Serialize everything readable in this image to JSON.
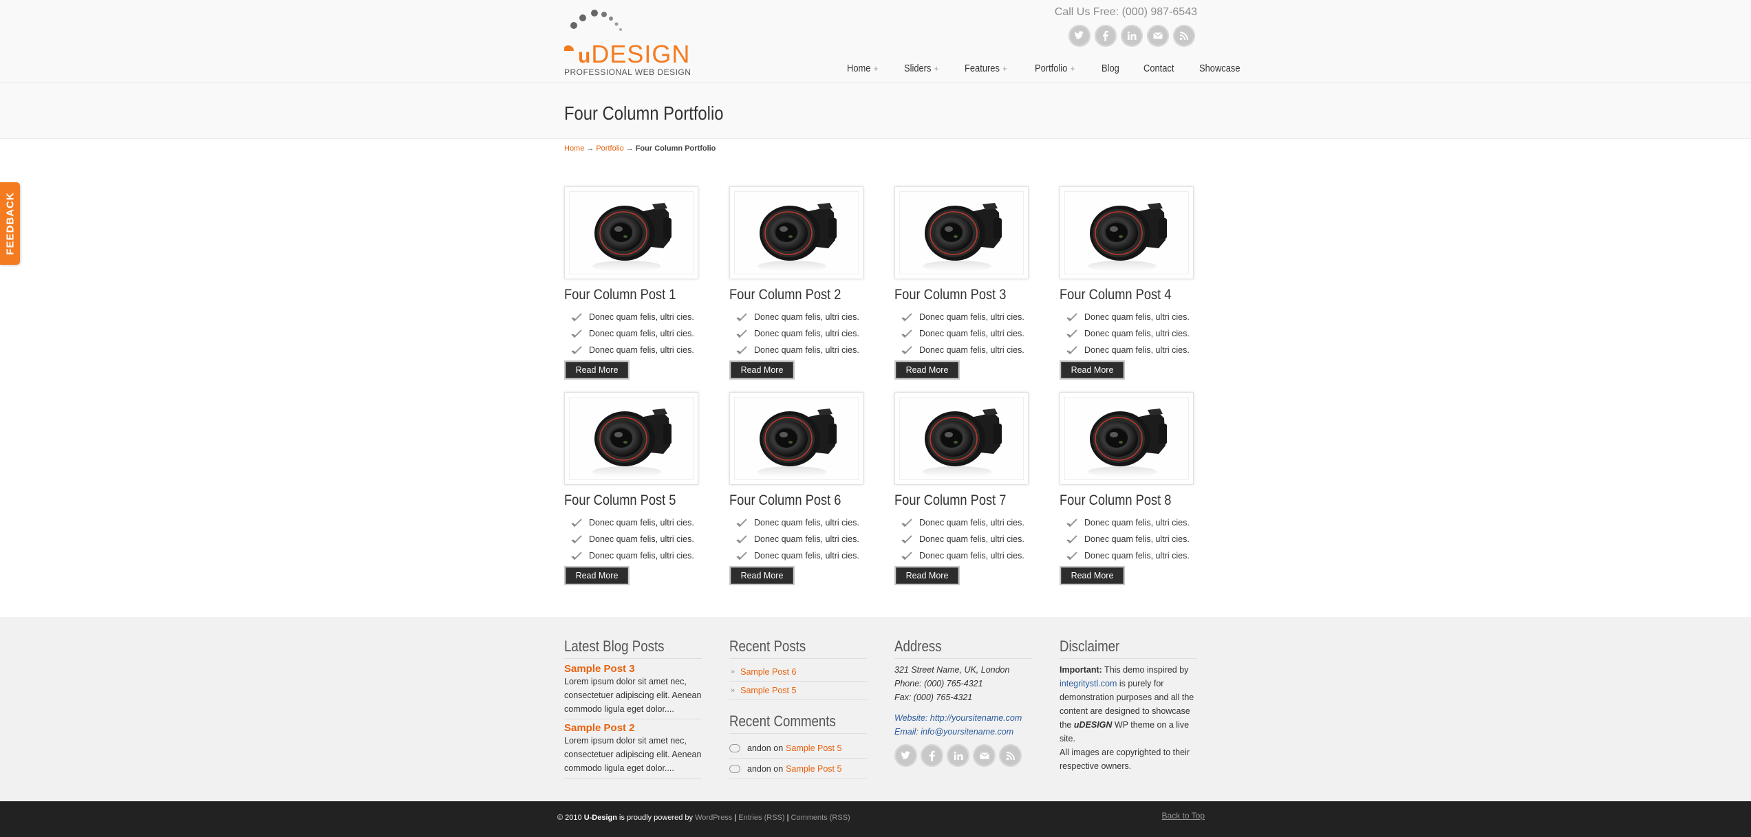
{
  "header": {
    "logo_text": "DESIGN",
    "logo_tagline": "PROFESSIONAL WEB DESIGN",
    "phone": "Call Us Free: (000) 987-6543",
    "social_icons": [
      "twitter-icon",
      "facebook-icon",
      "linkedin-icon",
      "email-icon",
      "rss-icon"
    ]
  },
  "nav": [
    {
      "label": "Home",
      "has_sub": "+"
    },
    {
      "label": "Sliders",
      "has_sub": "+"
    },
    {
      "label": "Features",
      "has_sub": "+"
    },
    {
      "label": "Portfolio",
      "has_sub": "+"
    },
    {
      "label": "Blog",
      "has_sub": ""
    },
    {
      "label": "Contact",
      "has_sub": ""
    },
    {
      "label": "Showcase",
      "has_sub": ""
    }
  ],
  "page_title": "Four Column Portfolio",
  "breadcrumb": {
    "home": "Home",
    "sep1": "→",
    "portfolio": "Portfolio",
    "sep2": "→",
    "current": "Four Column Portfolio"
  },
  "feedback_label": "FEEDBACK",
  "portfolio": {
    "read_more": "Read More",
    "posts": [
      {
        "title": "Four Column Post 1",
        "bullets": [
          "Donec quam felis, ultri cies.",
          "Donec quam felis, ultri cies.",
          "Donec quam felis, ultri cies."
        ]
      },
      {
        "title": "Four Column Post 2",
        "bullets": [
          "Donec quam felis, ultri cies.",
          "Donec quam felis, ultri cies.",
          "Donec quam felis, ultri cies."
        ]
      },
      {
        "title": "Four Column Post 3",
        "bullets": [
          "Donec quam felis, ultri cies.",
          "Donec quam felis, ultri cies.",
          "Donec quam felis, ultri cies."
        ]
      },
      {
        "title": "Four Column Post 4",
        "bullets": [
          "Donec quam felis, ultri cies.",
          "Donec quam felis, ultri cies.",
          "Donec quam felis, ultri cies."
        ]
      },
      {
        "title": "Four Column Post 5",
        "bullets": [
          "Donec quam felis, ultri cies.",
          "Donec quam felis, ultri cies.",
          "Donec quam felis, ultri cies."
        ]
      },
      {
        "title": "Four Column Post 6",
        "bullets": [
          "Donec quam felis, ultri cies.",
          "Donec quam felis, ultri cies.",
          "Donec quam felis, ultri cies."
        ]
      },
      {
        "title": "Four Column Post 7",
        "bullets": [
          "Donec quam felis, ultri cies.",
          "Donec quam felis, ultri cies.",
          "Donec quam felis, ultri cies."
        ]
      },
      {
        "title": "Four Column Post 8",
        "bullets": [
          "Donec quam felis, ultri cies.",
          "Donec quam felis, ultri cies.",
          "Donec quam felis, ultri cies."
        ]
      }
    ]
  },
  "footer": {
    "latest_blog": {
      "heading": "Latest Blog Posts",
      "posts": [
        {
          "title": "Sample Post 3",
          "text": "Lorem ipsum dolor sit amet nec, consectetuer adipiscing elit. Aenean commodo ligula eget dolor...."
        },
        {
          "title": "Sample Post 2",
          "text": "Lorem ipsum dolor sit amet nec, consectetuer adipiscing elit. Aenean commodo ligula eget dolor...."
        }
      ]
    },
    "recent_posts": {
      "heading": "Recent Posts",
      "items": [
        "Sample Post 6",
        "Sample Post 5"
      ]
    },
    "recent_comments": {
      "heading": "Recent Comments",
      "items": [
        {
          "author": "andon",
          "on": "on",
          "post": "Sample Post 5"
        },
        {
          "author": "andon",
          "on": "on",
          "post": "Sample Post 5"
        }
      ]
    },
    "address": {
      "heading": "Address",
      "street": "321 Street Name, UK, London",
      "phone": "Phone: (000) 765-4321",
      "fax": "Fax: (000) 765-4321",
      "website": "Website: http://yoursitename.com",
      "email": "Email: info@yoursitename.com"
    },
    "disclaimer": {
      "heading": "Disclaimer",
      "important": "Important:",
      "text1": " This demo inspired by ",
      "link": "integritystl.com",
      "text2": " is purely for demonstration purposes and all the content are designed to showcase the ",
      "brand": "uDESIGN",
      "text3": " WP theme on a live site.",
      "text4": "All images are copyrighted to their respective owners."
    }
  },
  "bottom": {
    "c1": "© 2010 ",
    "c2": "U-Design",
    "c3": " is proudly powered by ",
    "c4": "WordPress",
    "c5": " | ",
    "c6": "Entries (RSS)",
    "c7": " | ",
    "c8": "Comments (RSS)",
    "back_top": "Back to Top"
  },
  "colors": {
    "accent": "#f47b20",
    "link": "#e8620f",
    "dark_button": "#2d2d2d",
    "bottom_bar": "#222222"
  }
}
